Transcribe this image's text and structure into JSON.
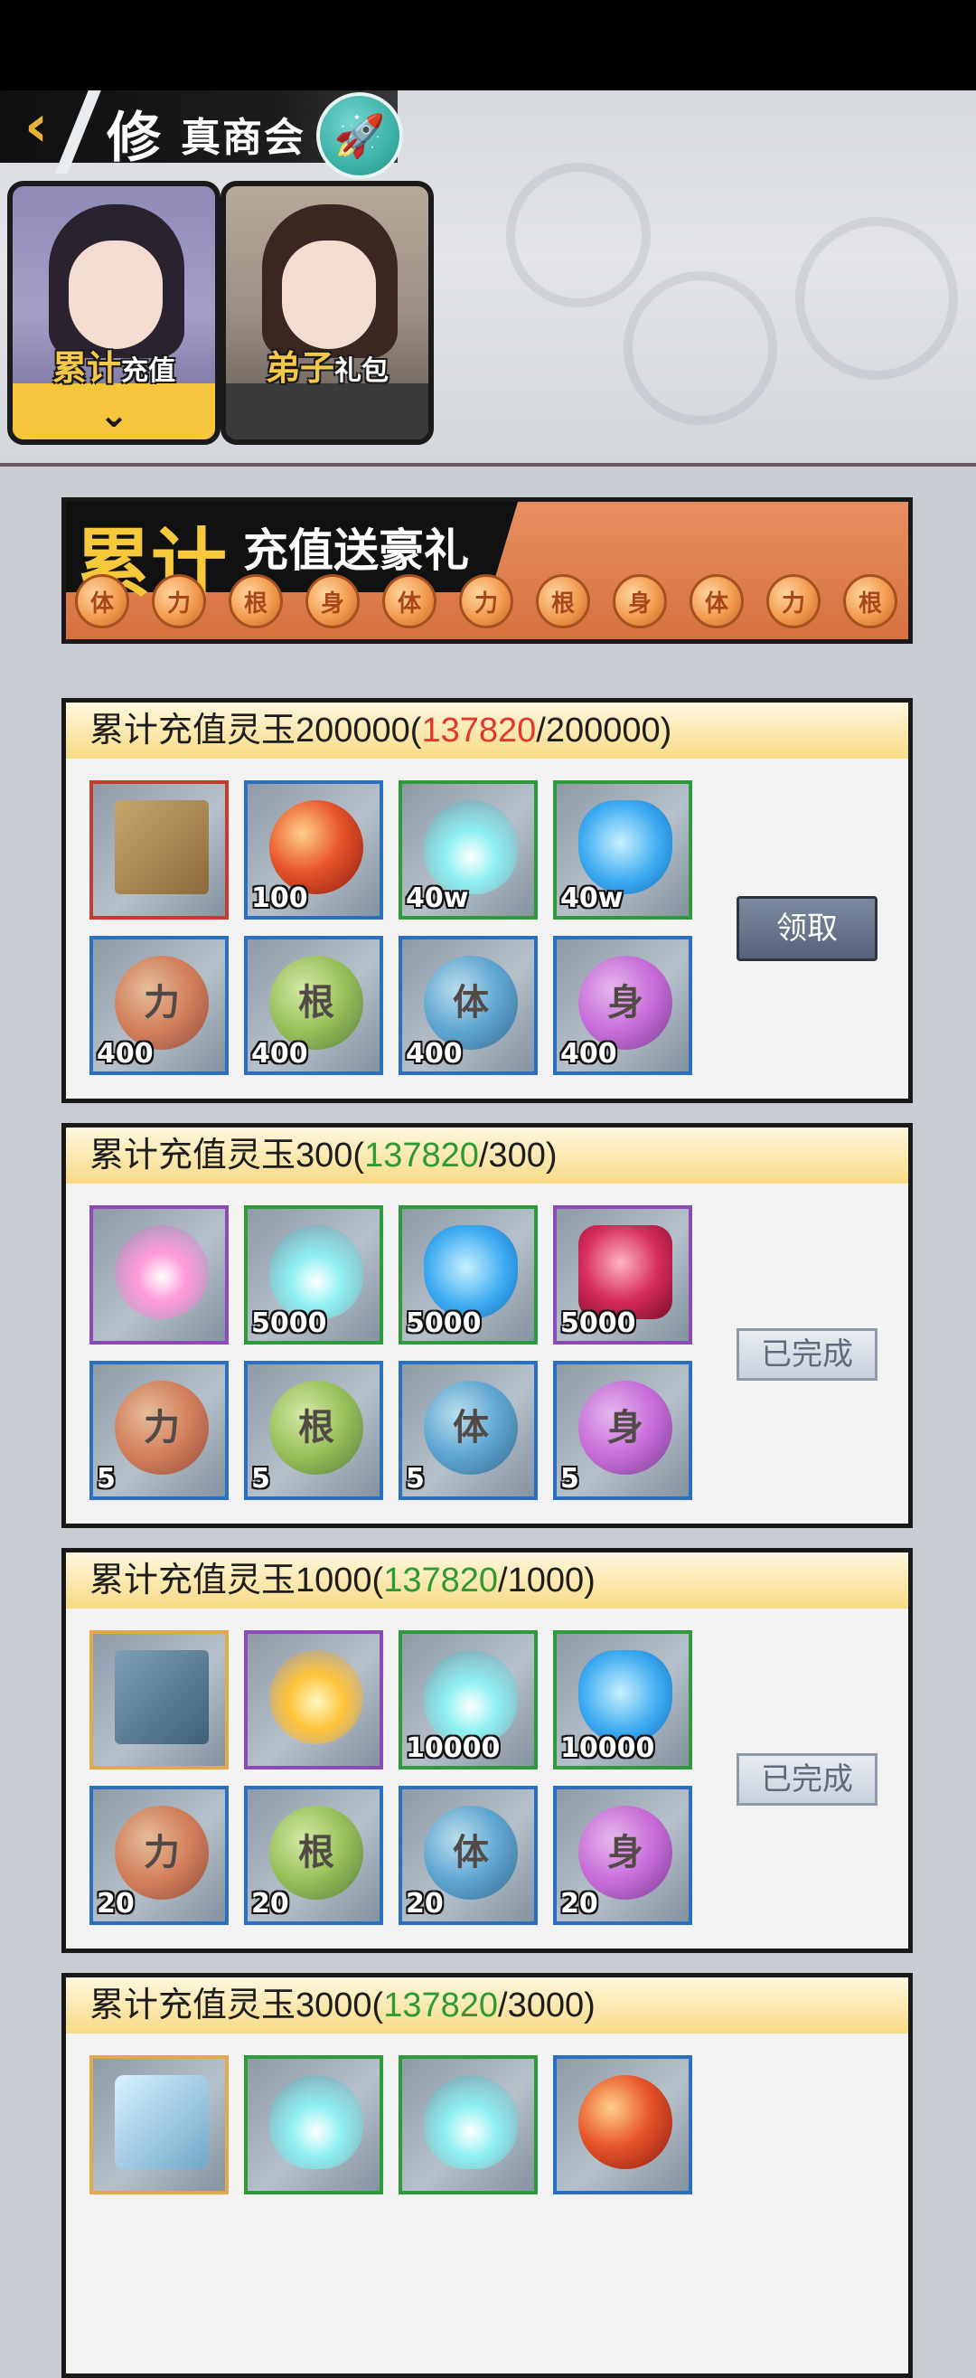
{
  "header": {
    "title_big": "修",
    "title": "真商会",
    "back_icon": "chevron-left-icon",
    "rocket_icon": "rocket-icon"
  },
  "tabs": [
    {
      "label_big": "累计",
      "label_small": "充值"
    },
    {
      "label_big": "弟子",
      "label_small": "礼包"
    }
  ],
  "banner": {
    "title_big": "累计",
    "title_small": "充值送豪礼",
    "coins": [
      "体",
      "力",
      "根",
      "身",
      "体",
      "力",
      "根",
      "身",
      "体",
      "力",
      "根"
    ]
  },
  "tiers": [
    {
      "title_prefix": "累计充值灵玉200000(",
      "progress": "137820",
      "title_suffix": "/200000)",
      "button": "领取",
      "items": [
        {
          "icon": "book-icon",
          "qty": ""
        },
        {
          "icon": "red-orb-icon",
          "qty": "100"
        },
        {
          "icon": "cyan-flame-icon",
          "qty": "40w"
        },
        {
          "icon": "water-pot-icon",
          "qty": "40w"
        },
        {
          "icon": "li-orb-icon",
          "glyph": "力",
          "qty": "400"
        },
        {
          "icon": "gen-orb-icon",
          "glyph": "根",
          "qty": "400"
        },
        {
          "icon": "ti-orb-icon",
          "glyph": "体",
          "qty": "400"
        },
        {
          "icon": "shen-orb-icon",
          "glyph": "身",
          "qty": "400"
        }
      ]
    },
    {
      "title_prefix": "累计充值灵玉300(",
      "progress": "137820",
      "title_suffix": "/300)",
      "button": "已完成",
      "items": [
        {
          "icon": "pink-fire-icon",
          "qty": ""
        },
        {
          "icon": "cyan-flame-icon",
          "qty": "5000"
        },
        {
          "icon": "water-pot-icon",
          "qty": "5000"
        },
        {
          "icon": "red-gem-icon",
          "qty": "5000"
        },
        {
          "icon": "li-orb-icon",
          "glyph": "力",
          "qty": "5"
        },
        {
          "icon": "gen-orb-icon",
          "glyph": "根",
          "qty": "5"
        },
        {
          "icon": "ti-orb-icon",
          "glyph": "体",
          "qty": "5"
        },
        {
          "icon": "shen-orb-icon",
          "glyph": "身",
          "qty": "5"
        }
      ]
    },
    {
      "title_prefix": "累计充值灵玉1000(",
      "progress": "137820",
      "title_suffix": "/1000)",
      "button": "已完成",
      "items": [
        {
          "icon": "manual-book-icon",
          "qty": ""
        },
        {
          "icon": "gold-fire-icon",
          "qty": ""
        },
        {
          "icon": "cyan-flame-icon",
          "qty": "10000"
        },
        {
          "icon": "water-pot-icon",
          "qty": "10000"
        },
        {
          "icon": "li-orb-icon",
          "glyph": "力",
          "qty": "20"
        },
        {
          "icon": "gen-orb-icon",
          "glyph": "根",
          "qty": "20"
        },
        {
          "icon": "ti-orb-icon",
          "glyph": "体",
          "qty": "20"
        },
        {
          "icon": "shen-orb-icon",
          "glyph": "身",
          "qty": "20"
        }
      ]
    },
    {
      "title_prefix": "累计充值灵玉3000(",
      "progress": "137820",
      "title_suffix": "/3000)",
      "items": [
        {
          "icon": "armor-icon",
          "qty": ""
        },
        {
          "icon": "cyan-flame-icon",
          "qty": ""
        },
        {
          "icon": "cyan-flame-icon",
          "qty": ""
        },
        {
          "icon": "red-orb-icon",
          "qty": ""
        }
      ]
    }
  ],
  "colors": {
    "progress_incomplete": "#e2372c",
    "progress_complete": "#2f9a33",
    "accent": "#f5c63c"
  }
}
